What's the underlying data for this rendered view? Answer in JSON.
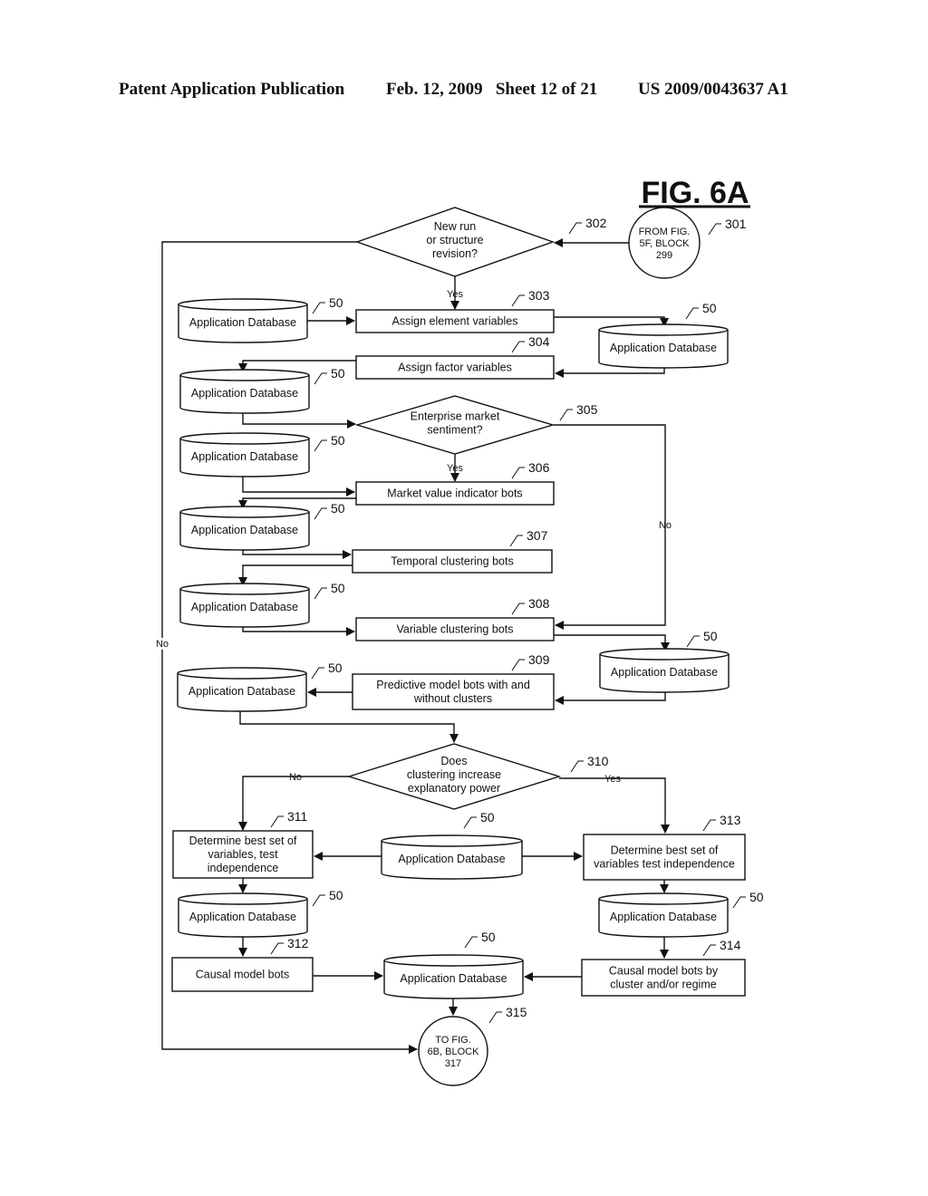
{
  "header": {
    "publication": "Patent Application Publication",
    "date_sheet": "Feb. 12, 2009   Sheet 12 of 21",
    "patent_number": "US 2009/0043637 A1"
  },
  "figure": {
    "title": "FIG. 6A",
    "db_label": "Application Database",
    "db_ref": "50",
    "connector_in": {
      "ref": "301",
      "lines": [
        "FROM FIG.",
        "5F, BLOCK",
        "299"
      ]
    },
    "connector_out": {
      "ref": "315",
      "lines": [
        "TO FIG.",
        "6B, BLOCK",
        "317"
      ]
    },
    "decisions": [
      {
        "ref": "302",
        "lines": [
          "New run",
          "or structure",
          "revision?"
        ],
        "yes": "Yes",
        "no": "No"
      },
      {
        "ref": "305",
        "lines": [
          "Enterprise market",
          "sentiment?"
        ],
        "yes": "Yes",
        "no": "No"
      },
      {
        "ref": "310",
        "lines": [
          "Does",
          "clustering increase",
          "explanatory power"
        ],
        "yes": "Yes",
        "no": "No"
      }
    ],
    "processes": [
      {
        "ref": "303",
        "lines": [
          "Assign element  variables"
        ]
      },
      {
        "ref": "304",
        "lines": [
          "Assign factor variables"
        ]
      },
      {
        "ref": "306",
        "lines": [
          "Market value indicator bots"
        ]
      },
      {
        "ref": "307",
        "lines": [
          "Temporal clustering bots"
        ]
      },
      {
        "ref": "308",
        "lines": [
          "Variable clustering bots"
        ]
      },
      {
        "ref": "309",
        "lines": [
          "Predictive model bots with and",
          "without clusters"
        ]
      },
      {
        "ref": "311",
        "lines": [
          "Determine best set of",
          "variables, test",
          "independence"
        ]
      },
      {
        "ref": "312",
        "lines": [
          "Causal model bots"
        ]
      },
      {
        "ref": "313",
        "lines": [
          "Determine best set of",
          "variables test independence"
        ]
      },
      {
        "ref": "314",
        "lines": [
          "Causal model bots by",
          "cluster and/or regime"
        ]
      }
    ]
  }
}
